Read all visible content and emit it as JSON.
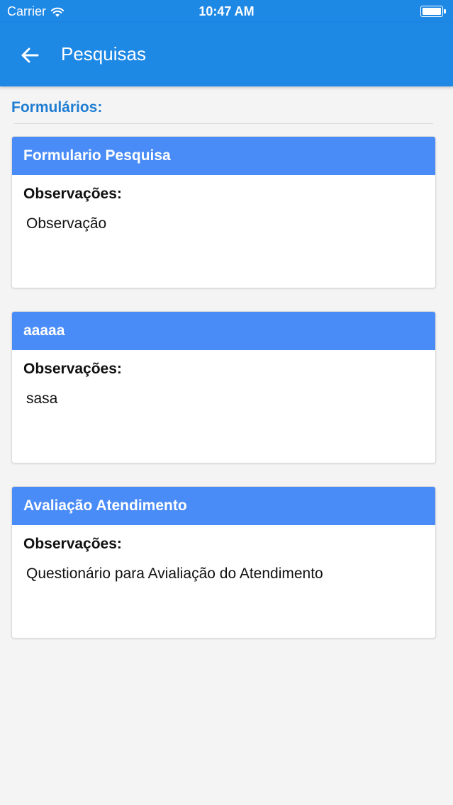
{
  "status_bar": {
    "carrier": "Carrier",
    "time": "10:47 AM",
    "wifi_icon": "wifi-icon",
    "battery_icon": "battery-icon",
    "battery_level": 1.0
  },
  "app_bar": {
    "title": "Pesquisas",
    "back_icon": "arrow-left-icon",
    "background_color": "#1e88e5"
  },
  "section": {
    "title": "Formulários:"
  },
  "cards": [
    {
      "title": "Formulario Pesquisa",
      "obs_label": "Observações:",
      "obs_text": "Observação"
    },
    {
      "title": "aaaaa",
      "obs_label": "Observações:",
      "obs_text": "sasa"
    },
    {
      "title": "Avaliação Atendimento",
      "obs_label": "Observações:",
      "obs_text": "Questionário para Avialiação do Atendimento"
    }
  ],
  "colors": {
    "card_header": "#4a8cf7",
    "section_title": "#1e7dd3",
    "background": "#f4f4f4"
  }
}
